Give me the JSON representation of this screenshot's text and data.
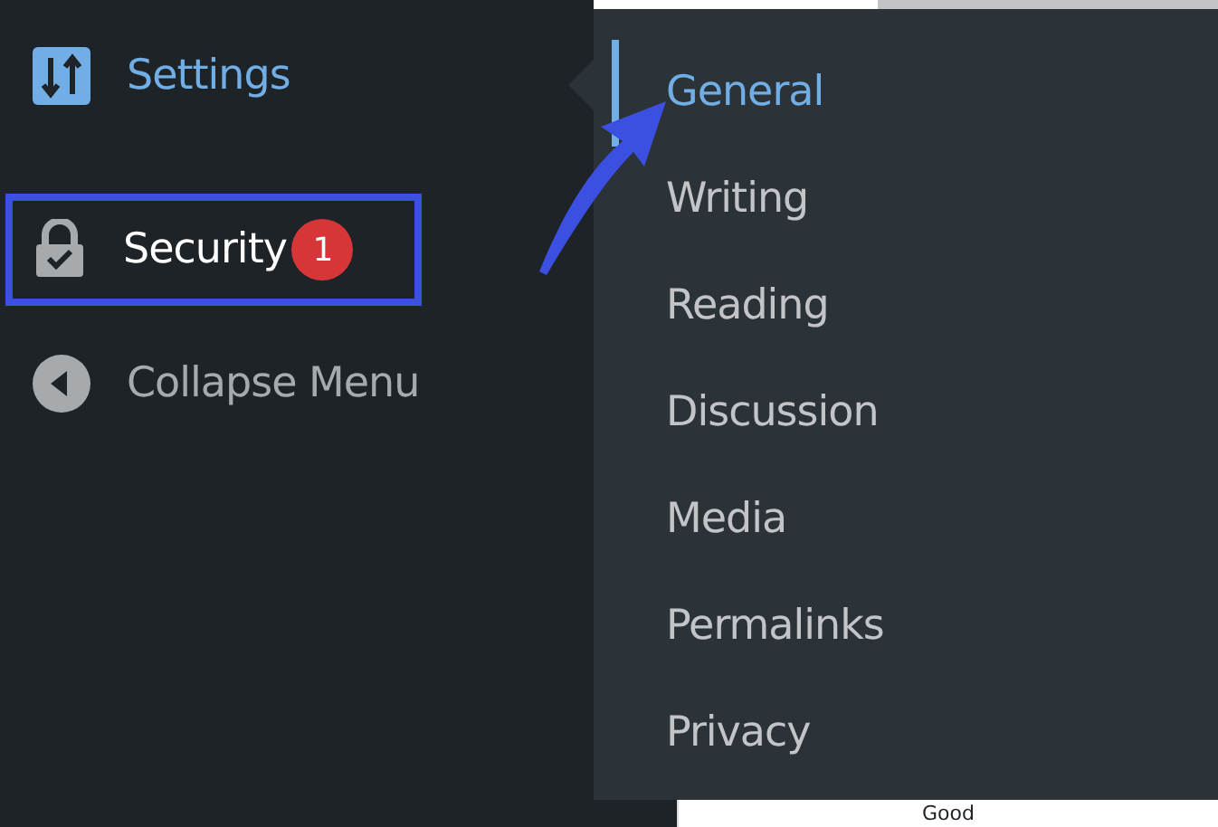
{
  "sidebar": {
    "items": [
      {
        "label": "Settings",
        "kind": "sliders",
        "selected": true,
        "highlighted": false
      },
      {
        "label": "Security",
        "kind": "lock",
        "selected": false,
        "highlighted": true,
        "badge": "1"
      },
      {
        "label": "Collapse Menu",
        "kind": "collapse",
        "selected": false,
        "highlighted": false
      }
    ]
  },
  "submenu": {
    "items": [
      {
        "label": "General",
        "selected": true
      },
      {
        "label": "Writing",
        "selected": false
      },
      {
        "label": "Reading",
        "selected": false
      },
      {
        "label": "Discussion",
        "selected": false
      },
      {
        "label": "Media",
        "selected": false
      },
      {
        "label": "Permalinks",
        "selected": false
      },
      {
        "label": "Privacy",
        "selected": false
      }
    ]
  },
  "background_text": "Good"
}
